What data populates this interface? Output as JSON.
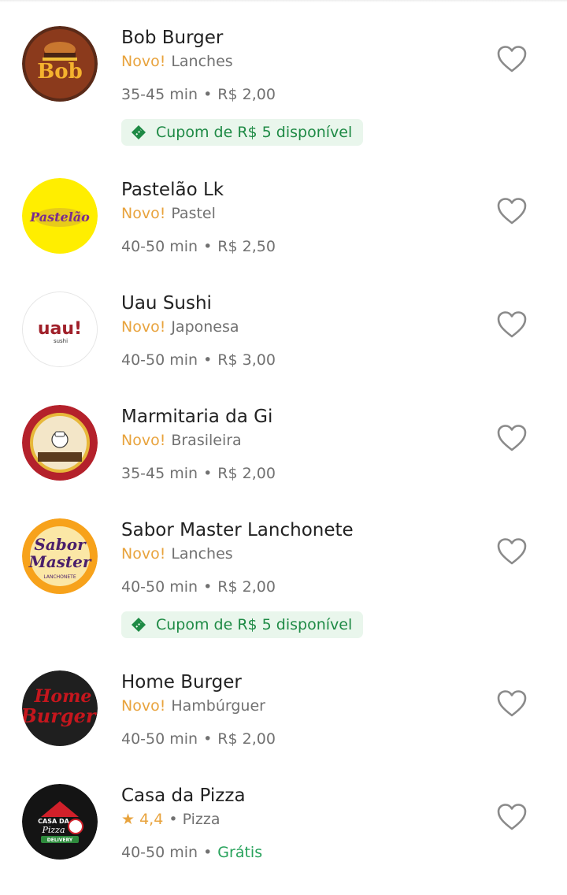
{
  "restaurants": [
    {
      "name": "Bob Burger",
      "badge": "Novo!",
      "category": "Lanches",
      "time": "35-45 min",
      "fee": "R$ 2,00",
      "coupon": "Cupom de R$ 5 disponível",
      "logo_text": "Bob"
    },
    {
      "name": "Pastelão Lk",
      "badge": "Novo!",
      "category": "Pastel",
      "time": "40-50 min",
      "fee": "R$ 2,50",
      "logo_text": "Pastelão"
    },
    {
      "name": "Uau Sushi",
      "badge": "Novo!",
      "category": "Japonesa",
      "time": "40-50 min",
      "fee": "R$ 3,00",
      "logo_text": "uau!",
      "logo_subtext": "sushi"
    },
    {
      "name": "Marmitaria da Gi",
      "badge": "Novo!",
      "category": "Brasileira",
      "time": "35-45 min",
      "fee": "R$ 2,00"
    },
    {
      "name": "Sabor Master Lanchonete",
      "badge": "Novo!",
      "category": "Lanches",
      "time": "40-50 min",
      "fee": "R$ 2,00",
      "coupon": "Cupom de R$ 5 disponível",
      "logo_text": "Sabor",
      "logo_text2": "Master",
      "logo_subtext": "LANCHONETE"
    },
    {
      "name": "Home Burger",
      "badge": "Novo!",
      "category": "Hambúrguer",
      "time": "40-50 min",
      "fee": "R$ 2,00",
      "logo_text": "Home",
      "logo_text2": "Burger"
    },
    {
      "name": "Casa da Pizza",
      "rating": "4,4",
      "category": "Pizza",
      "time": "40-50 min",
      "fee": "Grátis",
      "logo_text": "CASA DA",
      "logo_text2": "Pizza",
      "logo_subtext": "DELIVERY"
    }
  ],
  "separator": "•",
  "colors": {
    "badge": "#e8a33d",
    "coupon_bg": "#e9f6ec",
    "coupon_text": "#1e8a45",
    "free": "#27a25b",
    "heart": "#8a8a8a"
  },
  "icons": {
    "heart": "heart-outline-icon",
    "coupon": "ticket-icon",
    "rating": "star-icon"
  }
}
